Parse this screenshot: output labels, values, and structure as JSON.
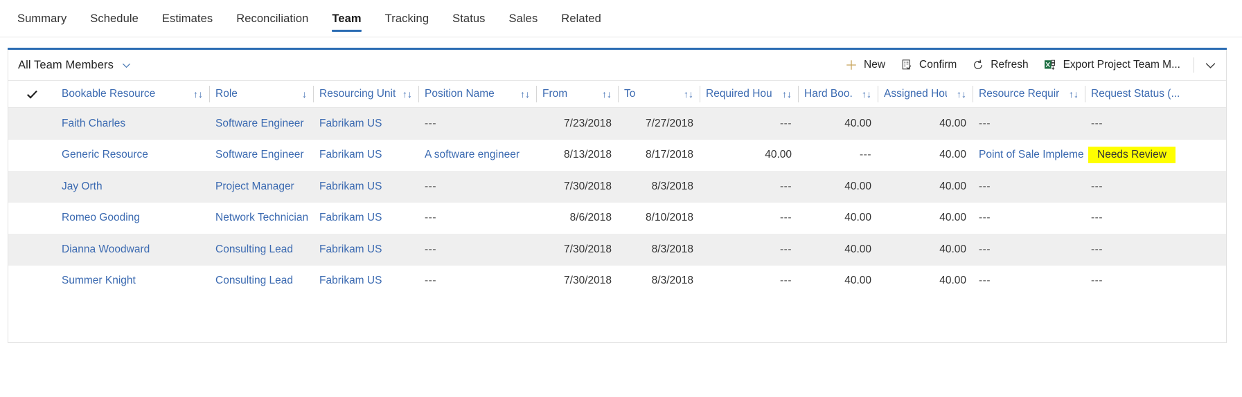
{
  "tabs": [
    {
      "label": "Summary",
      "active": false
    },
    {
      "label": "Schedule",
      "active": false
    },
    {
      "label": "Estimates",
      "active": false
    },
    {
      "label": "Reconciliation",
      "active": false
    },
    {
      "label": "Team",
      "active": true
    },
    {
      "label": "Tracking",
      "active": false
    },
    {
      "label": "Status",
      "active": false
    },
    {
      "label": "Sales",
      "active": false
    },
    {
      "label": "Related",
      "active": false
    }
  ],
  "commandbar": {
    "view_selector": "All Team Members",
    "new_label": "New",
    "confirm_label": "Confirm",
    "refresh_label": "Refresh",
    "export_label": "Export Project Team M..."
  },
  "grid": {
    "columns": [
      {
        "label": "Bookable Resource",
        "sort": "both",
        "numeric": false
      },
      {
        "label": "Role",
        "sort": "desc",
        "numeric": false
      },
      {
        "label": "Resourcing Unit",
        "sort": "both",
        "numeric": false
      },
      {
        "label": "Position Name",
        "sort": "both",
        "numeric": false
      },
      {
        "label": "From",
        "sort": "both",
        "numeric": false
      },
      {
        "label": "To",
        "sort": "both",
        "numeric": false
      },
      {
        "label": "Required Hours",
        "sort": "both",
        "numeric": true
      },
      {
        "label": "Hard Boo...",
        "sort": "both",
        "numeric": true
      },
      {
        "label": "Assigned Hours",
        "sort": "both",
        "numeric": true
      },
      {
        "label": "Resource Require...",
        "sort": "both",
        "numeric": true
      },
      {
        "label": "Request Status (...",
        "sort": "none",
        "numeric": false
      }
    ],
    "rows": [
      {
        "bookable_resource": "Faith Charles",
        "role": "Software Engineer",
        "resourcing_unit": "Fabrikam US",
        "position_name": "---",
        "from": "7/23/2018",
        "to": "7/27/2018",
        "required_hours": "---",
        "hard_booked": "40.00",
        "assigned_hours": "40.00",
        "resource_requirement": "---",
        "request_status": "---",
        "highlighted": false
      },
      {
        "bookable_resource": "Generic Resource",
        "role": "Software Engineer",
        "resourcing_unit": "Fabrikam US",
        "position_name": "A software engineer",
        "from": "8/13/2018",
        "to": "8/17/2018",
        "required_hours": "40.00",
        "hard_booked": "---",
        "assigned_hours": "40.00",
        "resource_requirement": "Point of Sale Impleme...",
        "request_status": "Needs Review",
        "highlighted": true
      },
      {
        "bookable_resource": "Jay Orth",
        "role": "Project Manager",
        "resourcing_unit": "Fabrikam US",
        "position_name": "---",
        "from": "7/30/2018",
        "to": "8/3/2018",
        "required_hours": "---",
        "hard_booked": "40.00",
        "assigned_hours": "40.00",
        "resource_requirement": "---",
        "request_status": "---",
        "highlighted": false
      },
      {
        "bookable_resource": "Romeo Gooding",
        "role": "Network Technician",
        "resourcing_unit": "Fabrikam US",
        "position_name": "---",
        "from": "8/6/2018",
        "to": "8/10/2018",
        "required_hours": "---",
        "hard_booked": "40.00",
        "assigned_hours": "40.00",
        "resource_requirement": "---",
        "request_status": "---",
        "highlighted": false
      },
      {
        "bookable_resource": "Dianna Woodward",
        "role": "Consulting Lead",
        "resourcing_unit": "Fabrikam US",
        "position_name": "---",
        "from": "7/30/2018",
        "to": "8/3/2018",
        "required_hours": "---",
        "hard_booked": "40.00",
        "assigned_hours": "40.00",
        "resource_requirement": "---",
        "request_status": "---",
        "highlighted": false
      },
      {
        "bookable_resource": "Summer Knight",
        "role": "Consulting Lead",
        "resourcing_unit": "Fabrikam US",
        "position_name": "---",
        "from": "7/30/2018",
        "to": "8/3/2018",
        "required_hours": "---",
        "hard_booked": "40.00",
        "assigned_hours": "40.00",
        "resource_requirement": "---",
        "request_status": "---",
        "highlighted": false
      }
    ]
  },
  "colors": {
    "accent": "#2b6cb3",
    "link": "#3b6ab1",
    "highlight": "#ffff00",
    "alt_row": "#efefef",
    "new_icon": "#c8a45c"
  }
}
